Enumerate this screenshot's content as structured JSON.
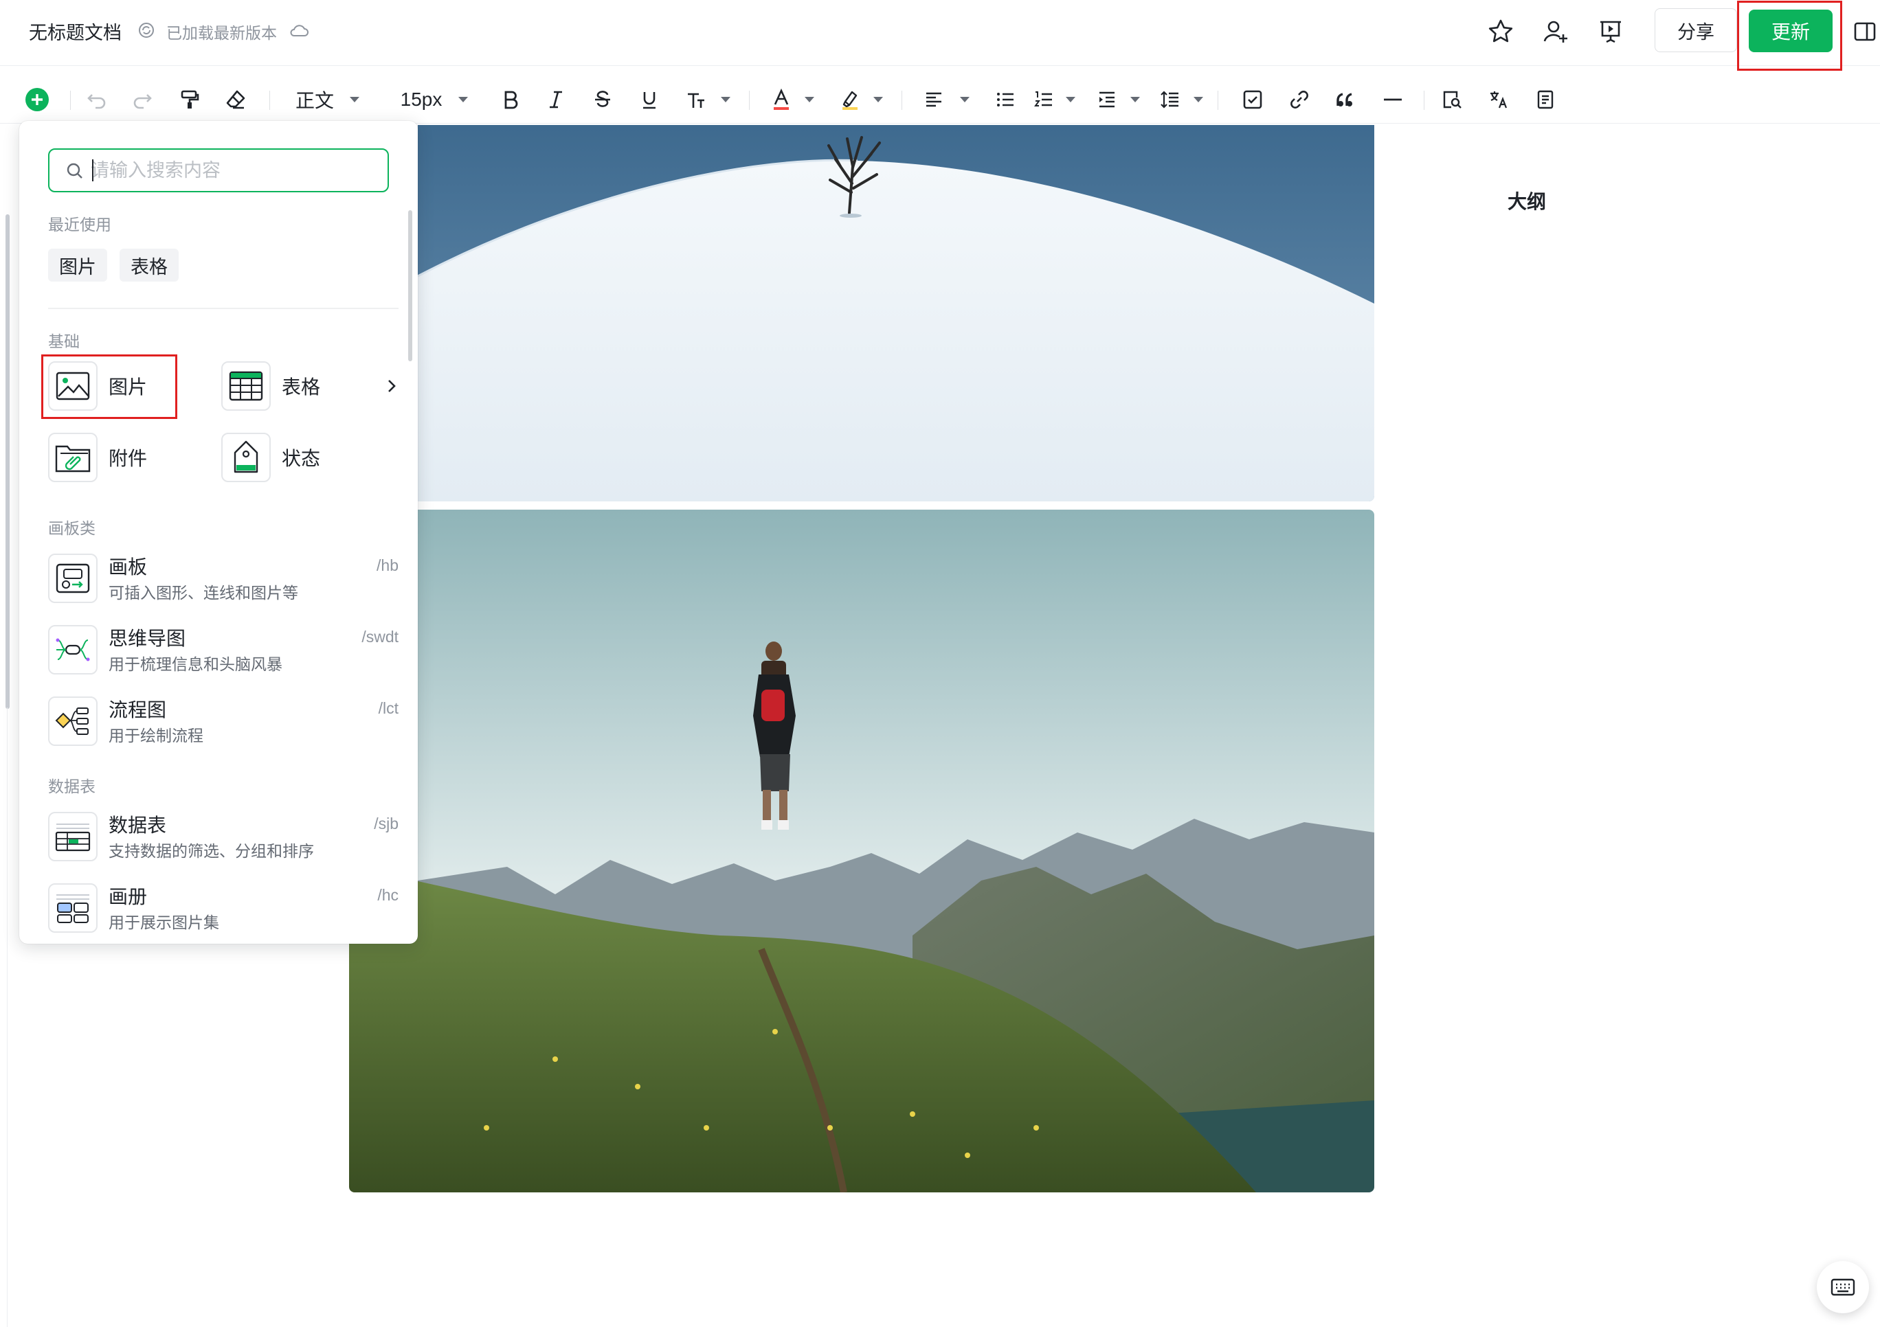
{
  "header": {
    "doc_title": "无标题文档",
    "sync_status": "已加载最新版本",
    "share_label": "分享",
    "update_label": "更新"
  },
  "toolbar": {
    "paragraph_style": "正文",
    "font_size": "15px",
    "icons": [
      "add-icon",
      "undo-icon",
      "redo-icon",
      "format-painter-icon",
      "clear-format-icon",
      "bold-icon",
      "italic-icon",
      "strikethrough-icon",
      "underline-icon",
      "text-style-icon",
      "font-color-icon",
      "highlight-icon",
      "align-icon",
      "bullet-list-icon",
      "ordered-list-icon",
      "indent-icon",
      "line-height-icon",
      "checkbox-icon",
      "link-icon",
      "quote-icon",
      "divider-icon",
      "find-icon",
      "translate-icon",
      "note-icon"
    ],
    "accent_color": "#0cb35c",
    "font_color_underline": "#f54a45",
    "highlight_underline": "#fad355"
  },
  "insert_panel": {
    "search_placeholder": "请输入搜索内容",
    "recent_title": "最近使用",
    "recent_items": [
      "图片",
      "表格"
    ],
    "basic_title": "基础",
    "basic_items": [
      {
        "label": "图片",
        "icon": "image-icon"
      },
      {
        "label": "表格",
        "icon": "table-icon"
      },
      {
        "label": "附件",
        "icon": "attachment-icon"
      },
      {
        "label": "状态",
        "icon": "status-tag-icon"
      }
    ],
    "board_title": "画板类",
    "board_items": [
      {
        "title": "画板",
        "desc": "可插入图形、连线和图片等",
        "shortcut": "/hb",
        "icon": "whiteboard-icon"
      },
      {
        "title": "思维导图",
        "desc": "用于梳理信息和头脑风暴",
        "shortcut": "/swdt",
        "icon": "mindmap-icon"
      },
      {
        "title": "流程图",
        "desc": "用于绘制流程",
        "shortcut": "/lct",
        "icon": "flowchart-icon"
      }
    ],
    "data_title": "数据表",
    "data_items": [
      {
        "title": "数据表",
        "desc": "支持数据的筛选、分组和排序",
        "shortcut": "/sjb",
        "icon": "datatable-icon"
      },
      {
        "title": "画册",
        "desc": "用于展示图片集",
        "shortcut": "/hc",
        "icon": "album-icon"
      }
    ]
  },
  "outline": {
    "title": "大纲"
  },
  "highlight_color": "#e02020"
}
